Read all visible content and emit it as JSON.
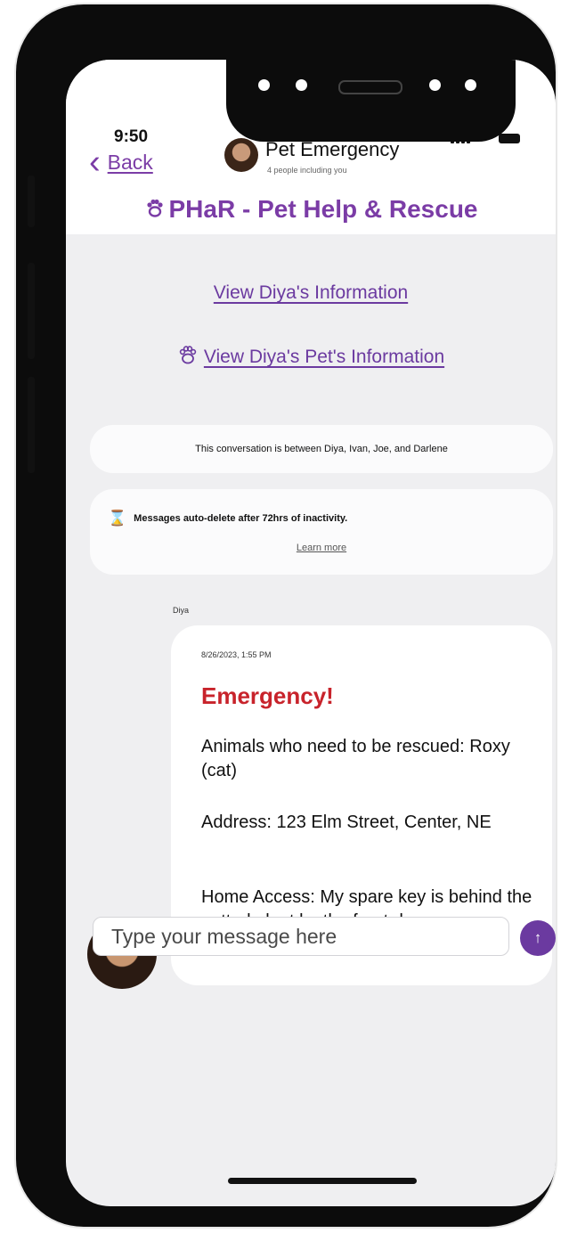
{
  "status_bar": {
    "time": "9:50"
  },
  "nav": {
    "back_label": "Back",
    "contact_name": "Pet Emergency",
    "contact_subtitle": "4 people including you"
  },
  "app": {
    "title": "PHaR - Pet Help & Rescue",
    "icon": "paw-icon"
  },
  "links": {
    "owner_info": "View Diya's Information",
    "pet_info": "View Diya's Pet's Information"
  },
  "notices": {
    "participants": "This conversation is between Diya, Ivan, Joe, and Darlene",
    "auto_delete": "Messages auto-delete after 72hrs of inactivity.",
    "learn_more": "Learn more"
  },
  "message": {
    "sender": "Diya",
    "timestamp": "8/26/2023, 1:55 PM",
    "heading": "Emergency!",
    "animals": "Animals who need to be rescued: Roxy (cat)",
    "address": "Address: 123 Elm Street, Center, NE",
    "home_access": "Home Access:  My spare key is behind the potted plant by the front door."
  },
  "composer": {
    "placeholder": "Type your message here",
    "send_icon": "arrow-up-icon"
  },
  "colors": {
    "accent": "#7b3ca6",
    "emergency": "#c8232b",
    "background": "#efeff1"
  }
}
